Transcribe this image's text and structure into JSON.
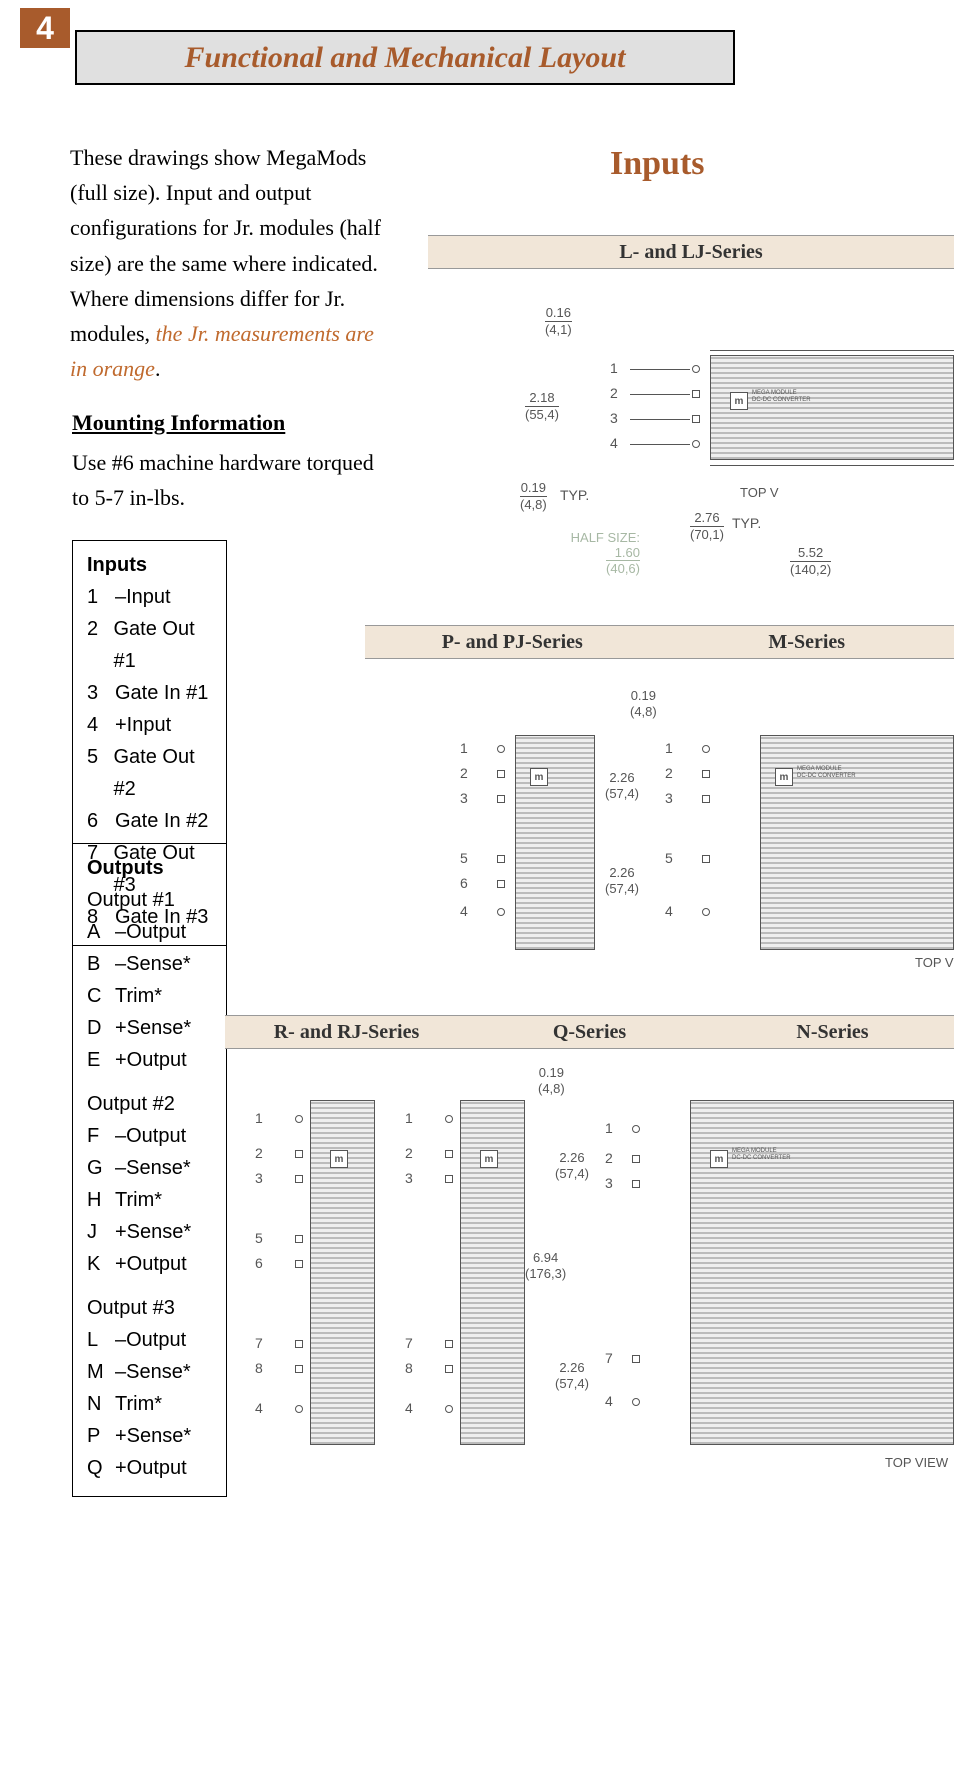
{
  "page_number": "4",
  "title": "Functional and Mechanical Layout",
  "intro_plain_1": "These drawings show MegaMods (full size). Input and output configurations for Jr. modules (half size) are the same where indicated. Where dimensions differ for Jr. modules, ",
  "intro_orange": "the Jr. measurements are in orange",
  "intro_plain_2": ".",
  "mounting": {
    "heading": "Mounting Information",
    "body": "Use #6 machine hardware torqued to 5-7 in-lbs."
  },
  "inputs_legend": {
    "title": "Inputs",
    "rows": [
      {
        "k": "1",
        "v": "–Input"
      },
      {
        "k": "2",
        "v": "Gate Out #1"
      },
      {
        "k": "3",
        "v": "Gate In #1"
      },
      {
        "k": "4",
        "v": "+Input"
      },
      {
        "k": "5",
        "v": "Gate Out #2"
      },
      {
        "k": "6",
        "v": "Gate In #2"
      },
      {
        "k": "7",
        "v": "Gate Out #3"
      },
      {
        "k": "8",
        "v": "Gate In #3"
      }
    ]
  },
  "outputs_legend": {
    "title": "Outputs",
    "group1_title": "Output #1",
    "group1": [
      {
        "k": "A",
        "v": "–Output"
      },
      {
        "k": "B",
        "v": "–Sense*"
      },
      {
        "k": "C",
        "v": "Trim*"
      },
      {
        "k": "D",
        "v": "+Sense*"
      },
      {
        "k": "E",
        "v": "+Output"
      }
    ],
    "group2_title": "Output #2",
    "group2": [
      {
        "k": "F",
        "v": "–Output"
      },
      {
        "k": "G",
        "v": "–Sense*"
      },
      {
        "k": "H",
        "v": "Trim*"
      },
      {
        "k": "J",
        "v": "+Sense*"
      },
      {
        "k": "K",
        "v": "+Output"
      }
    ],
    "group3_title": "Output #3",
    "group3": [
      {
        "k": "L",
        "v": "–Output"
      },
      {
        "k": "M",
        "v": "–Sense*"
      },
      {
        "k": "N",
        "v": "Trim*"
      },
      {
        "k": "P",
        "v": "+Sense*"
      },
      {
        "k": "Q",
        "v": "+Output"
      }
    ]
  },
  "right_heading": "Inputs",
  "series_labels": {
    "l": "L- and LJ-Series",
    "p": "P- and PJ-Series",
    "m": "M-Series",
    "r": "R- and RJ-Series",
    "q": "Q-Series",
    "n": "N-Series"
  },
  "dimensions": {
    "d016": "0.16",
    "d016mm": "(4,1)",
    "d218": "2.18",
    "d218mm": "(55,4)",
    "d019": "0.19",
    "d019mm": "(4,8)",
    "d276": "2.76",
    "d276mm": "(70,1)",
    "d552": "5.52",
    "d552mm": "(140,2)",
    "d160": "1.60",
    "d160mm": "(40,6)",
    "d226": "2.26",
    "d226mm": "(57,4)",
    "d694": "6.94",
    "d694mm": "(176,3)",
    "typ": "TYP.",
    "halfsize": "HALF SIZE:",
    "topview": "TOP VIEW",
    "topview_short": "TOP V"
  },
  "pins": {
    "p1": "1",
    "p2": "2",
    "p3": "3",
    "p4": "4",
    "p5": "5",
    "p6": "6",
    "p7": "7",
    "p8": "8"
  },
  "logo_text": "m",
  "logo_label1": "MEGA MODULE",
  "logo_label2": "DC-DC CONVERTER"
}
